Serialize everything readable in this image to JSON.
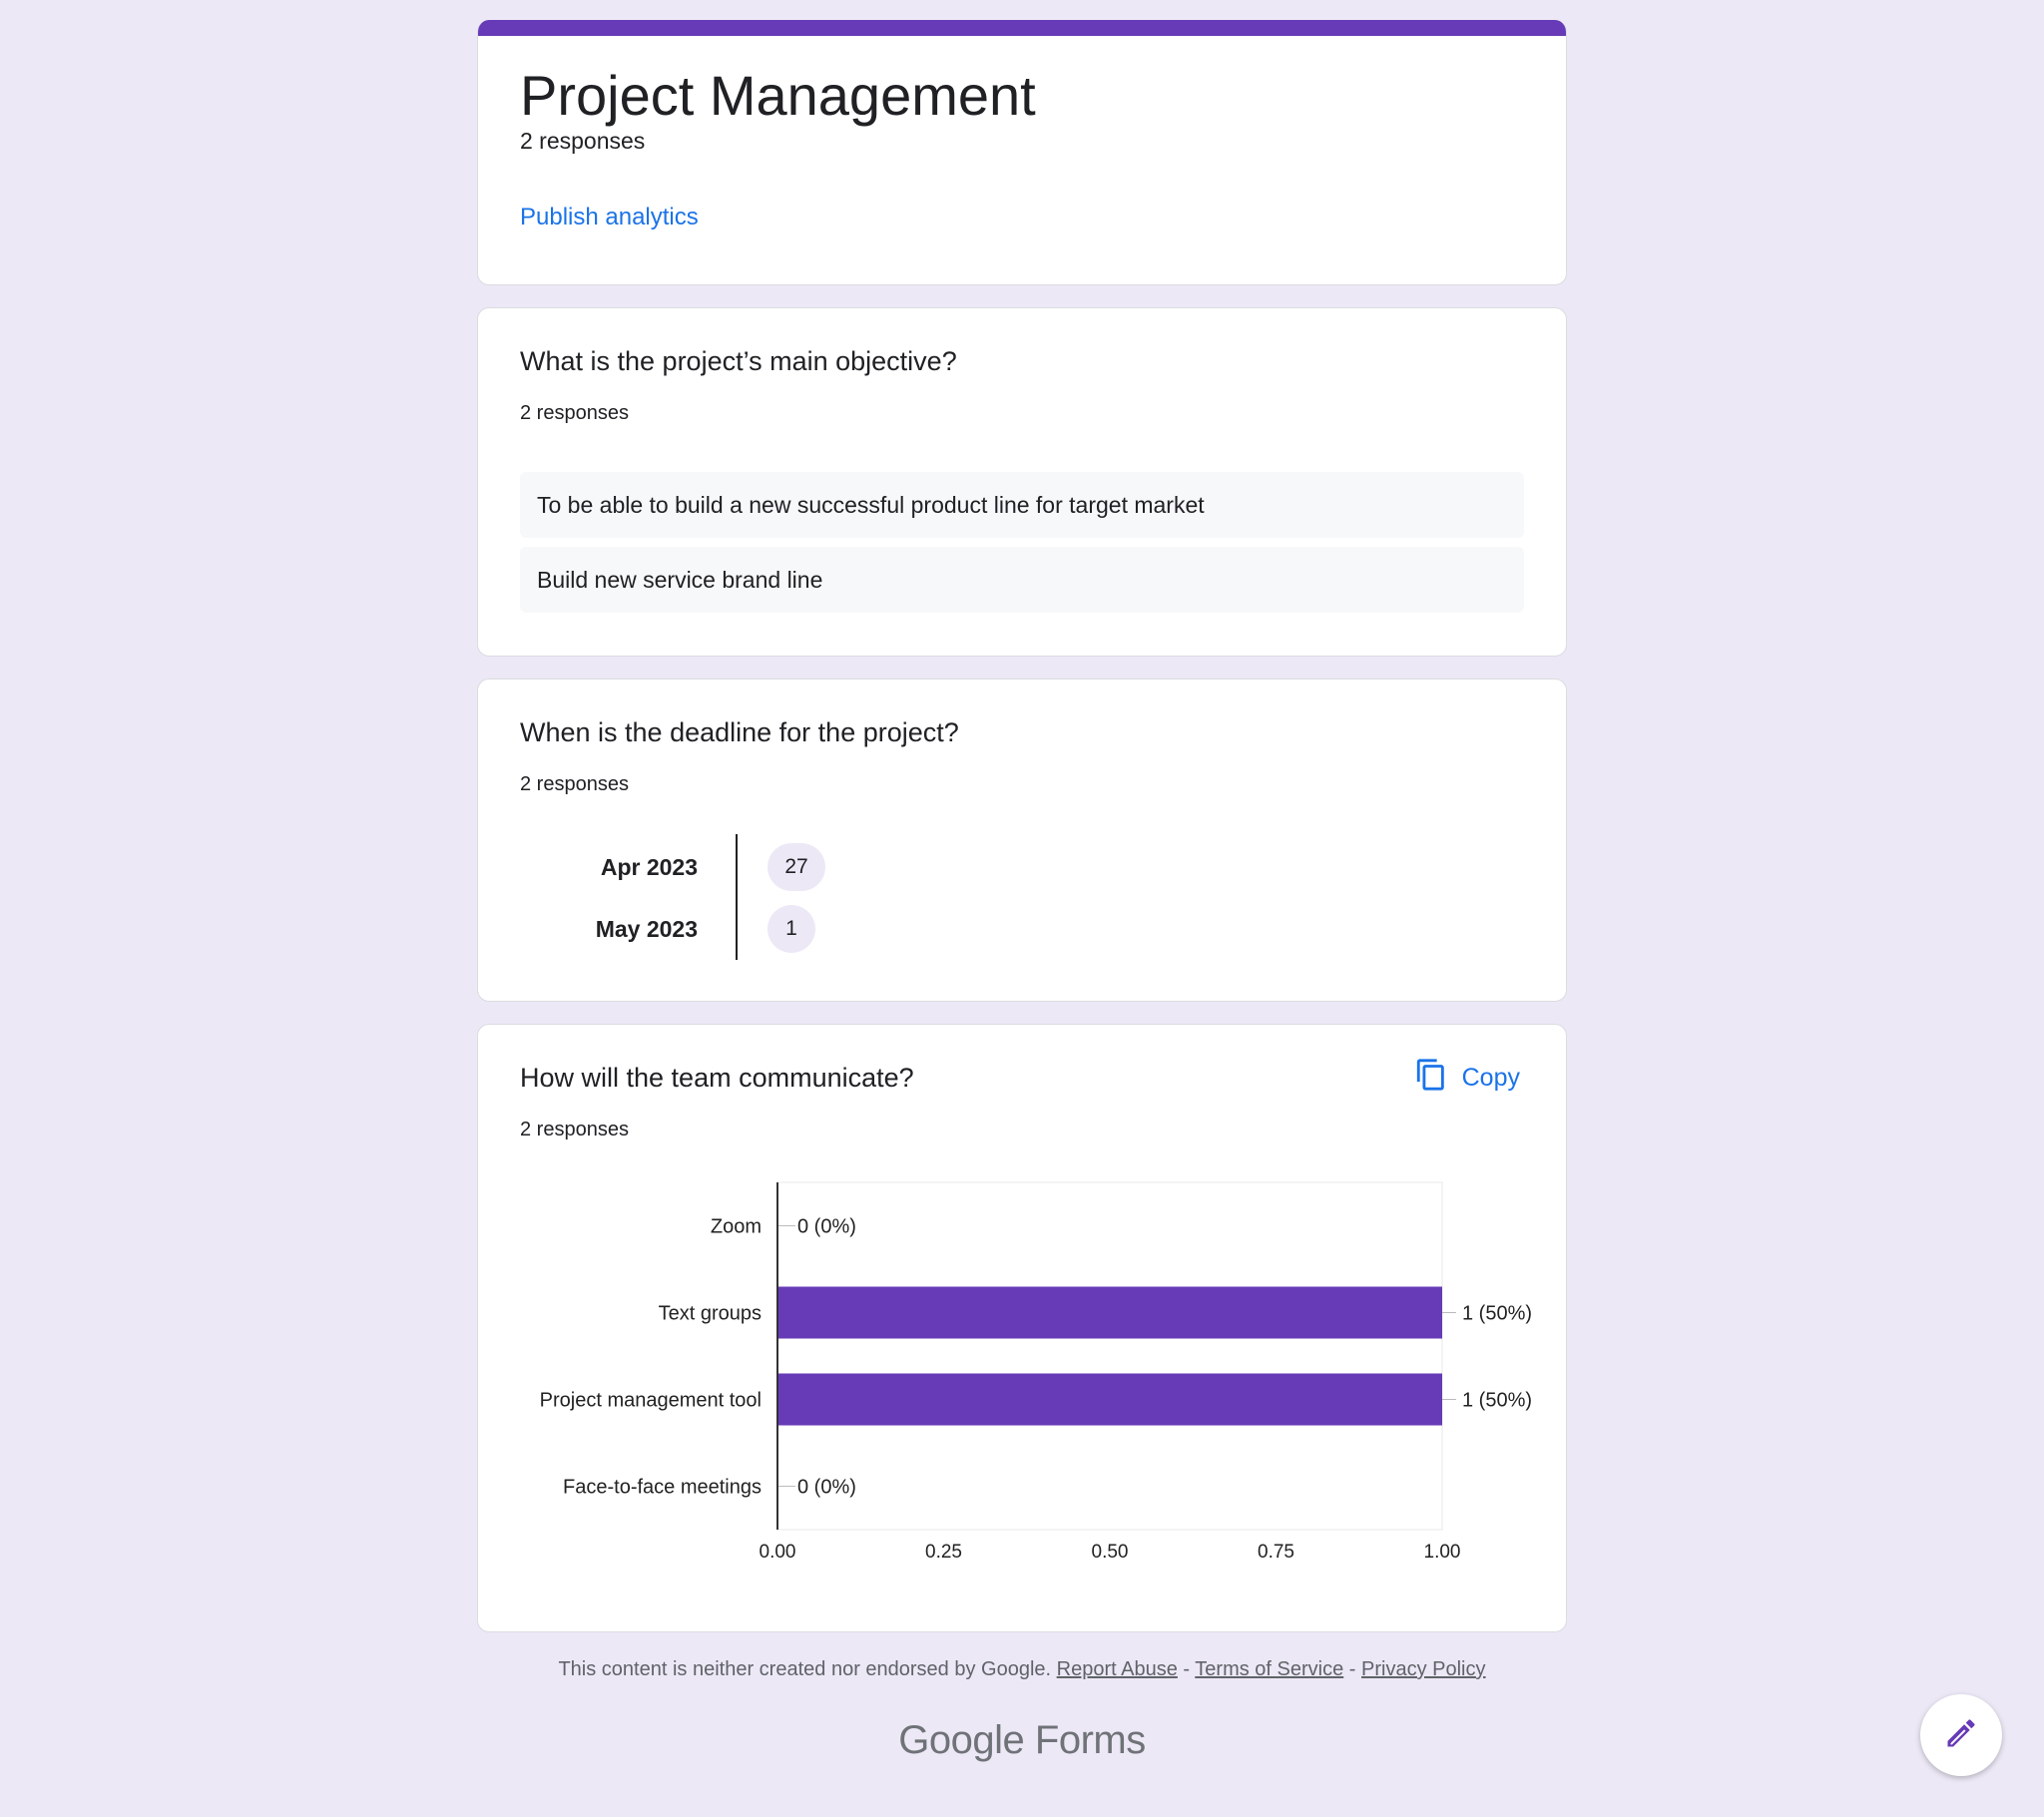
{
  "form": {
    "title": "Project Management",
    "responses": "2 responses",
    "publish_label": "Publish analytics"
  },
  "questions": [
    {
      "title": "What is the project’s main objective?",
      "responses": "2 responses",
      "answers": [
        "To be able to build a new successful product line for target market",
        "Build new service brand line"
      ]
    },
    {
      "title": "When is the deadline for the project?",
      "responses": "2 responses",
      "dates": [
        {
          "month": "Apr 2023",
          "days": [
            "27"
          ]
        },
        {
          "month": "May 2023",
          "days": [
            "1"
          ]
        }
      ]
    },
    {
      "title": "How will the team communicate?",
      "responses": "2 responses",
      "copy_label": "Copy"
    }
  ],
  "chart_data": {
    "type": "bar",
    "orientation": "horizontal",
    "categories": [
      "Zoom",
      "Text groups",
      "Project management tool",
      "Face-to-face meetings"
    ],
    "values": [
      0,
      1,
      1,
      0
    ],
    "data_labels": [
      "0 (0%)",
      "1 (50%)",
      "1 (50%)",
      "0 (0%)"
    ],
    "xlim": [
      0,
      1
    ],
    "xticks": [
      "0.00",
      "0.25",
      "0.50",
      "0.75",
      "1.00"
    ],
    "xtick_values": [
      0,
      0.25,
      0.5,
      0.75,
      1
    ],
    "bar_color": "#673ab7",
    "grid": false
  },
  "footer": {
    "notice": "This content is neither created nor endorsed by Google.",
    "report_abuse": "Report Abuse",
    "sep1": "-",
    "terms": "Terms of Service",
    "sep2": "-",
    "privacy": "Privacy Policy",
    "brand_google": "Google",
    "brand_forms": "Forms"
  },
  "icons": {
    "copy": "copy-icon",
    "edit": "pencil-icon"
  },
  "colors": {
    "accent": "#673ab7",
    "link": "#1a73e8",
    "background": "#ede8f6"
  }
}
